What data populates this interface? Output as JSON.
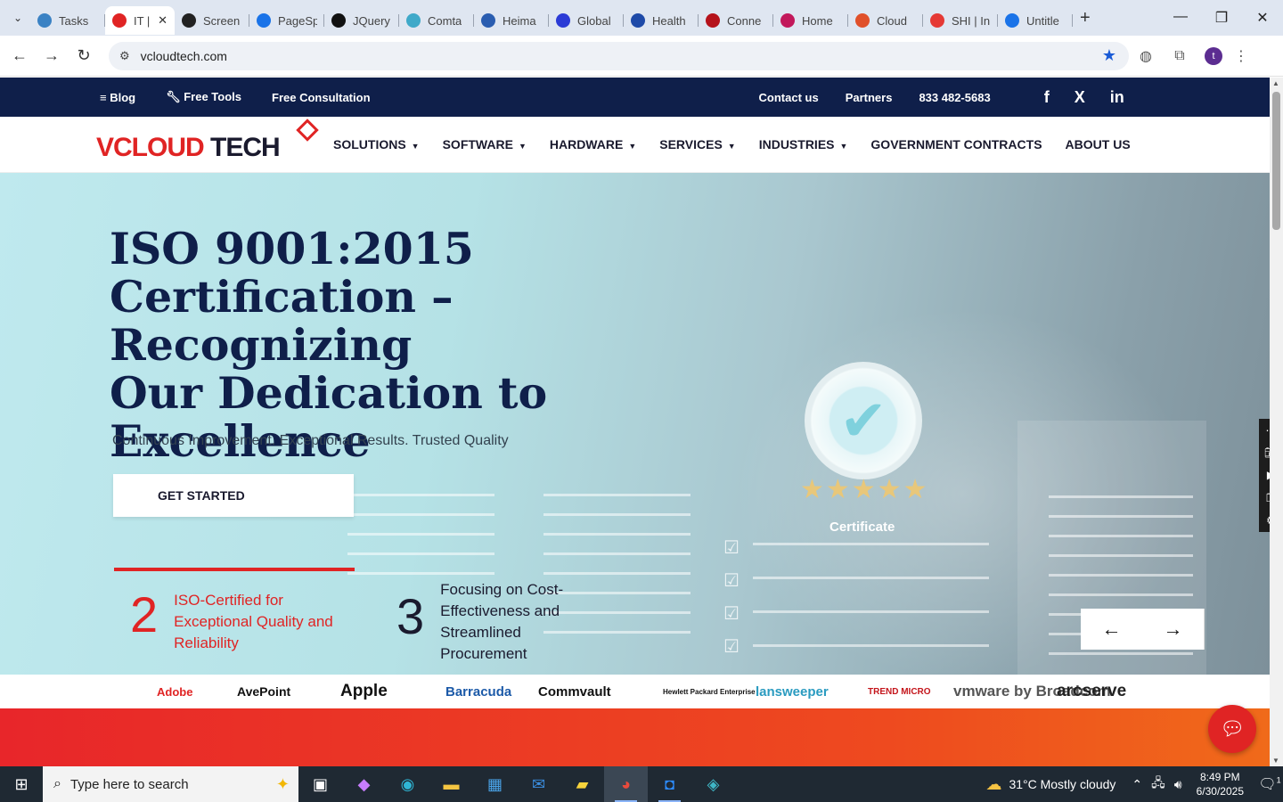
{
  "browser": {
    "tabs": [
      {
        "title": "Tasks",
        "color": "#3b82c4"
      },
      {
        "title": "IT |",
        "color": "#e02424",
        "active": true
      },
      {
        "title": "Screen",
        "color": "#222222"
      },
      {
        "title": "PageSp",
        "color": "#1a73e8"
      },
      {
        "title": "JQuery",
        "color": "#111111"
      },
      {
        "title": "Comta",
        "color": "#3fa9c9"
      },
      {
        "title": "Heima",
        "color": "#2a5db0"
      },
      {
        "title": "Global",
        "color": "#2b3bd6"
      },
      {
        "title": "Health",
        "color": "#1e4aa8"
      },
      {
        "title": "Conne",
        "color": "#b5121b"
      },
      {
        "title": "Home",
        "color": "#c2185b"
      },
      {
        "title": "Cloud",
        "color": "#e0502a"
      },
      {
        "title": "SHI | In",
        "color": "#e53935"
      },
      {
        "title": "Untitle",
        "color": "#1a73e8"
      }
    ],
    "url": "vcloudtech.com",
    "profile_initial": "t"
  },
  "topstrip": {
    "blog": "Blog",
    "free_tools": "Free Tools",
    "free_consultation": "Free Consultation",
    "contact": "Contact us",
    "partners": "Partners",
    "phone": "833 482-5683",
    "social": [
      "f",
      "X",
      "in"
    ]
  },
  "logo": {
    "v": "V",
    "cloud": "CLOUD",
    "tech": " TECH"
  },
  "nav": [
    {
      "label": "SOLUTIONS",
      "caret": true
    },
    {
      "label": "SOFTWARE",
      "caret": true
    },
    {
      "label": "HARDWARE",
      "caret": true
    },
    {
      "label": "SERVICES",
      "caret": true
    },
    {
      "label": "INDUSTRIES",
      "caret": true
    },
    {
      "label": "GOVERNMENT CONTRACTS",
      "caret": false
    },
    {
      "label": "ABOUT US",
      "caret": false
    }
  ],
  "hero": {
    "title_lines": [
      "ISO 9001:2015",
      "Certification – Recognizing",
      "Our Dedication to",
      "Excellence"
    ],
    "subtitle": "Continuous Improvement. Exceptional Results. Trusted Quality",
    "cta": "GET STARTED",
    "cert_label": "Certificate",
    "stat1": {
      "num": "2",
      "label": "ISO-Certified for Exceptional Quality and Reliability"
    },
    "stat2": {
      "num": "3",
      "label": "Focusing on Cost-Effectiveness and Streamlined Procurement"
    },
    "prev_arrow": "←",
    "next_arrow": "→"
  },
  "partners": [
    "Adobe",
    "AvePoint",
    "Apple",
    "Barracuda",
    "Commvault",
    "Hewlett Packard Enterprise",
    "lansweeper",
    "TREND MICRO",
    "vmware by Broadcom",
    "arcserve"
  ],
  "taskbar": {
    "search_placeholder": "Type here to search",
    "weather": "31°C  Mostly cloudy",
    "time": "8:49 PM",
    "date": "6/30/2025",
    "notif_count": "1"
  }
}
